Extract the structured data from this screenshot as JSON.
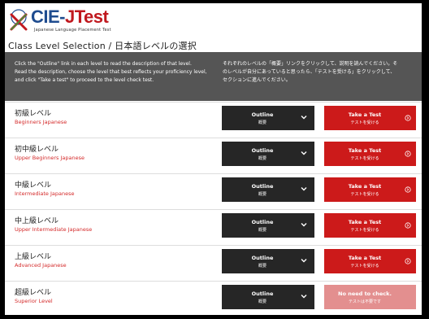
{
  "header": {
    "logo_text_part1": "CIE-",
    "logo_text_part2": "JTest",
    "logo_subtitle": "Japanese Language Placement Test",
    "page_title": "Class Level Selection / 日本語レベルの選択"
  },
  "instructions": {
    "en_line1": "Click the \"Outline\" link in each level to read the description of that level.",
    "en_line2": "Read the description, choose the level that best reflects your proficiency level,",
    "en_line3": "and click \"Take a test\" to proceed to the level check test.",
    "ja_line1": "それぞれのレベルの「概要」リンクをクリックして、説明を読んでください。そ",
    "ja_line2": "のレベルが自分にあっていると思ったら、「テストを受ける」をクリックして、",
    "ja_line3": "セクションに進んでください。"
  },
  "levels": [
    {
      "name_ja": "初級レベル",
      "name_en": "Beginners Japanese",
      "outline_label": "Outline",
      "outline_sub": "概要",
      "test_label": "Take a Test",
      "test_sub": "テストを受ける"
    },
    {
      "name_ja": "初中級レベル",
      "name_en": "Upper Beginners Japanese",
      "outline_label": "Outline",
      "outline_sub": "概要",
      "test_label": "Take a Test",
      "test_sub": "テストを受ける"
    },
    {
      "name_ja": "中級レベル",
      "name_en": "Intermediate Japanese",
      "outline_label": "Outline",
      "outline_sub": "概要",
      "test_label": "Take a Test",
      "test_sub": "テストを受ける"
    },
    {
      "name_ja": "中上級レベル",
      "name_en": "Upper Intermediate Japanese",
      "outline_label": "Outline",
      "outline_sub": "概要",
      "test_label": "Take a Test",
      "test_sub": "テストを受ける"
    },
    {
      "name_ja": "上級レベル",
      "name_en": "Advanced Japanese",
      "outline_label": "Outline",
      "outline_sub": "概要",
      "test_label": "Take a Test",
      "test_sub": "テストを受ける"
    },
    {
      "name_ja": "超級レベル",
      "name_en": "Superior Level",
      "outline_label": "Outline",
      "outline_sub": "概要",
      "test_label": "No need to check.",
      "test_sub": "テストは不要です"
    }
  ],
  "colors": {
    "brand_blue": "#1f4c8f",
    "brand_red": "#c0181e",
    "outline_button": "#262626",
    "test_button": "#cc1a1a",
    "test_button_disabled": "#e38f8f",
    "instructions_bg": "#555555"
  },
  "icons": {
    "logo": "cie-logo-icon",
    "outline": "chevron-down-icon",
    "test": "circle-arrow-icon"
  }
}
